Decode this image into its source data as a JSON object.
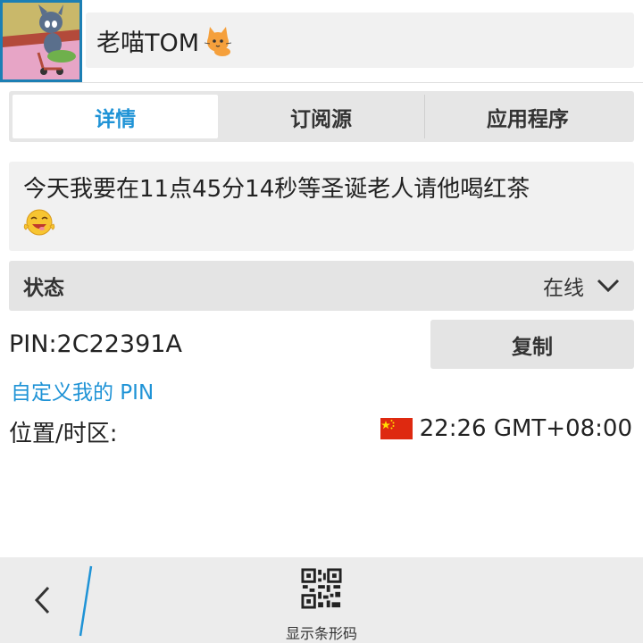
{
  "profile": {
    "display_name": "老喵TOM",
    "name_emoji_icon": "cat-face-icon",
    "avatar_icon": "cartoon-cat-avatar-icon"
  },
  "tabs": [
    {
      "label": "详情",
      "active": true
    },
    {
      "label": "订阅源",
      "active": false
    },
    {
      "label": "应用程序",
      "active": false
    }
  ],
  "status_message": {
    "text": "今天我要在11点45分14秒等圣诞老人请他喝红茶",
    "emoji_icon": "smiley-face-icon"
  },
  "status": {
    "label": "状态",
    "value": "在线",
    "dropdown_icon": "chevron-down-icon"
  },
  "pin": {
    "text": "PIN:2C22391A",
    "copy_label": "复制",
    "custom_link": "自定义我的 PIN"
  },
  "location": {
    "label": "位置/时区:",
    "flag_icon": "china-flag-icon",
    "time": "22:26 GMT+08:00"
  },
  "bottom_bar": {
    "back_icon": "back-chevron-icon",
    "barcode_label": "显示条形码",
    "barcode_icon": "qr-code-icon"
  },
  "colors": {
    "accent": "#1f93d6",
    "avatar_border": "#1c7fb4",
    "flag_red": "#de2910",
    "flag_yellow": "#ffde00"
  }
}
